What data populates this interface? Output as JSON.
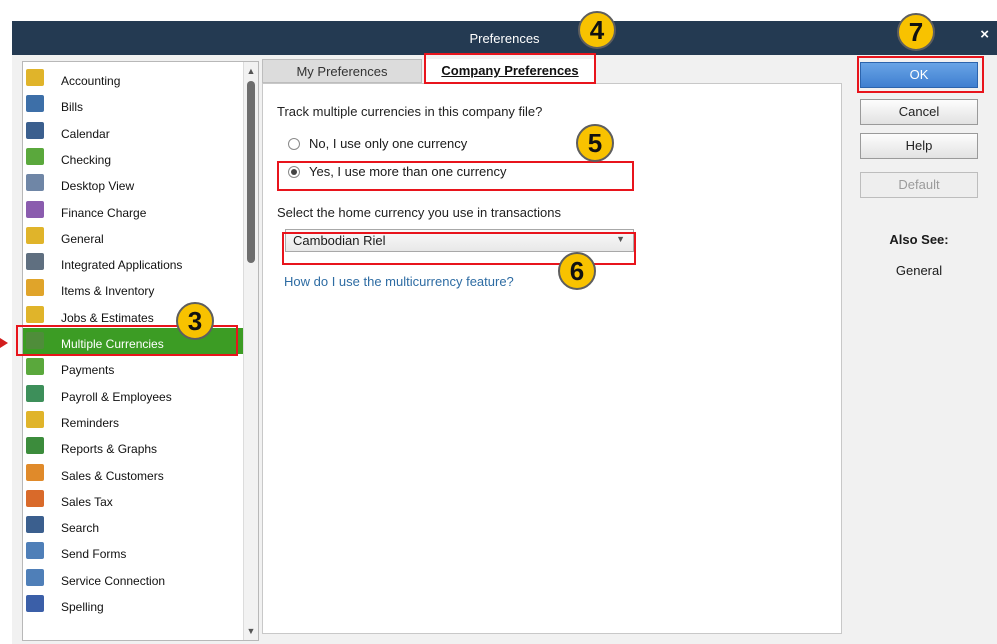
{
  "window": {
    "title": "Preferences",
    "close_glyph": "×"
  },
  "categories": [
    {
      "label": "Accounting",
      "icon": "accounting-icon",
      "color": "#e0b42a"
    },
    {
      "label": "Bills",
      "icon": "bills-icon",
      "color": "#3d6fa8"
    },
    {
      "label": "Calendar",
      "icon": "calendar-icon",
      "color": "#3b5f8e"
    },
    {
      "label": "Checking",
      "icon": "checking-icon",
      "color": "#5aa83c"
    },
    {
      "label": "Desktop View",
      "icon": "desktop-view-icon",
      "color": "#6f86a6"
    },
    {
      "label": "Finance Charge",
      "icon": "finance-charge-icon",
      "color": "#8a5cae"
    },
    {
      "label": "General",
      "icon": "general-icon",
      "color": "#e0b42a"
    },
    {
      "label": "Integrated Applications",
      "icon": "integrated-apps-icon",
      "color": "#5f6f80"
    },
    {
      "label": "Items & Inventory",
      "icon": "items-inventory-icon",
      "color": "#e0a42a"
    },
    {
      "label": "Jobs & Estimates",
      "icon": "jobs-estimates-icon",
      "color": "#e0b42a"
    },
    {
      "label": "Multiple Currencies",
      "icon": "multiple-currencies-icon",
      "color": "#4f8d3a"
    },
    {
      "label": "Payments",
      "icon": "payments-icon",
      "color": "#5aa83c"
    },
    {
      "label": "Payroll & Employees",
      "icon": "payroll-employees-icon",
      "color": "#3d8f5a"
    },
    {
      "label": "Reminders",
      "icon": "reminders-icon",
      "color": "#e0b42a"
    },
    {
      "label": "Reports & Graphs",
      "icon": "reports-graphs-icon",
      "color": "#3c8c3c"
    },
    {
      "label": "Sales & Customers",
      "icon": "sales-customers-icon",
      "color": "#e08a2a"
    },
    {
      "label": "Sales Tax",
      "icon": "sales-tax-icon",
      "color": "#d96a2a"
    },
    {
      "label": "Search",
      "icon": "search-icon",
      "color": "#3b5f8e"
    },
    {
      "label": "Send Forms",
      "icon": "send-forms-icon",
      "color": "#4f7fb8"
    },
    {
      "label": "Service Connection",
      "icon": "service-connection-icon",
      "color": "#4f7fb8"
    },
    {
      "label": "Spelling",
      "icon": "spelling-icon",
      "color": "#3b5fa8"
    }
  ],
  "selected_category_index": 10,
  "tabs": {
    "my_preferences": "My Preferences",
    "company_preferences": "Company Preferences",
    "active": "company_preferences"
  },
  "content": {
    "question": "Track multiple currencies in this company file?",
    "option_no": "No, I use only one currency",
    "option_yes": "Yes, I use more than one currency",
    "selected_option": "yes",
    "home_currency_label": "Select the home currency you use in transactions",
    "home_currency_value": "Cambodian Riel",
    "help_link": "How do I use the multicurrency feature?"
  },
  "buttons": {
    "ok": "OK",
    "cancel": "Cancel",
    "help": "Help",
    "default": "Default"
  },
  "also_see": {
    "heading": "Also See:",
    "link": "General"
  },
  "annotations": {
    "step3": "3",
    "step4": "4",
    "step5": "5",
    "step6": "6",
    "step7": "7",
    "highlight_color": "#e8141c",
    "badge_color": "#f8c200"
  },
  "scrollbar": {
    "up_glyph": "▲",
    "down_glyph": "▼"
  },
  "select_arrow_glyph": "▼"
}
